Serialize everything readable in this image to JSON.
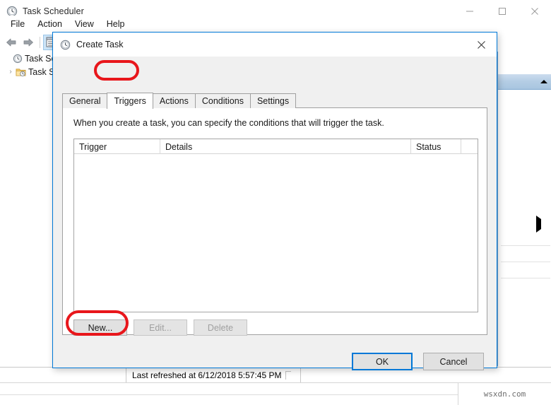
{
  "app": {
    "title": "Task Scheduler",
    "icon": "clock-icon",
    "window_controls": {
      "minimize": "minimize-icon",
      "maximize": "maximize-icon",
      "close": "close-icon"
    },
    "menu": [
      {
        "label": "File"
      },
      {
        "label": "Action"
      },
      {
        "label": "View"
      },
      {
        "label": "Help"
      }
    ],
    "toolbar": [
      {
        "name": "back-icon",
        "label": "Back"
      },
      {
        "name": "forward-icon",
        "label": "Forward"
      },
      {
        "name": "show-hide-console-tree-icon",
        "label": "Show/Hide Console Tree"
      }
    ],
    "tree": [
      {
        "label": "Task Sche",
        "icon": "clock-icon",
        "twisty": ""
      },
      {
        "label": "Task S",
        "icon": "folder-clock-icon",
        "twisty": "›"
      }
    ],
    "actions_pane": {
      "collapse": "triangle-up-icon",
      "expand": "triangle-right-icon"
    },
    "statusbar": {
      "message": "Last refreshed at 6/12/2018 5:57:45 PM"
    },
    "watermark": "wsxdn.com"
  },
  "dialog": {
    "title": "Create Task",
    "icon": "clock-icon",
    "close": "close-icon",
    "tabs": [
      {
        "label": "General",
        "selected": false
      },
      {
        "label": "Triggers",
        "selected": true
      },
      {
        "label": "Actions",
        "selected": false
      },
      {
        "label": "Conditions",
        "selected": false
      },
      {
        "label": "Settings",
        "selected": false
      }
    ],
    "description": "When you create a task, you can specify the conditions that will trigger the task.",
    "trigger_list": {
      "columns": [
        "Trigger",
        "Details",
        "Status"
      ],
      "rows": []
    },
    "list_buttons": [
      {
        "label": "New...",
        "enabled": true
      },
      {
        "label": "Edit...",
        "enabled": false
      },
      {
        "label": "Delete",
        "enabled": false
      }
    ],
    "footer_buttons": [
      {
        "label": "OK",
        "default": true
      },
      {
        "label": "Cancel",
        "default": false
      }
    ]
  },
  "annotations": {
    "color": "#e8161b",
    "highlights": [
      "Triggers tab",
      "New... button"
    ]
  }
}
